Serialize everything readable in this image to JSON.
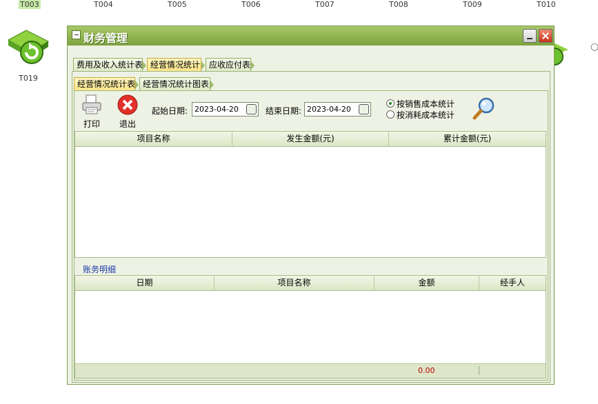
{
  "desktop": {
    "table_codes": [
      "T003",
      "T004",
      "T005",
      "T006",
      "T007",
      "T008",
      "T009",
      "T010"
    ],
    "selected_code": "T003",
    "icon_label": "T019"
  },
  "window": {
    "title": "财务管理",
    "tabs": [
      "费用及收入统计表",
      "经营情况统计",
      "应收应付表"
    ],
    "active_tab": "经营情况统计",
    "subtabs": [
      "经营情况统计表",
      "经营情况统计图表"
    ],
    "active_subtab": "经营情况统计表"
  },
  "toolbar": {
    "print_label": "打印",
    "exit_label": "退出",
    "start_date_label": "起始日期:",
    "start_date": "2023-04-20",
    "end_date_label": "结束日期:",
    "end_date": "2023-04-20",
    "radio_sales": "按销售成本统计",
    "radio_consume": "按消耗成本统计",
    "selected_radio": "按销售成本统计"
  },
  "summary_table": {
    "columns": [
      "项目名称",
      "发生金额(元)",
      "累计金额(元)"
    ]
  },
  "detail": {
    "section_label": "账务明细",
    "columns": [
      "日期",
      "项目名称",
      "金额",
      "经手人"
    ],
    "total_amount": "0.00"
  },
  "colors": {
    "title_bar": "#7da33f",
    "window_bg": "#eef2e4",
    "active_tab": "#fde58a",
    "total_text": "#c00000"
  }
}
